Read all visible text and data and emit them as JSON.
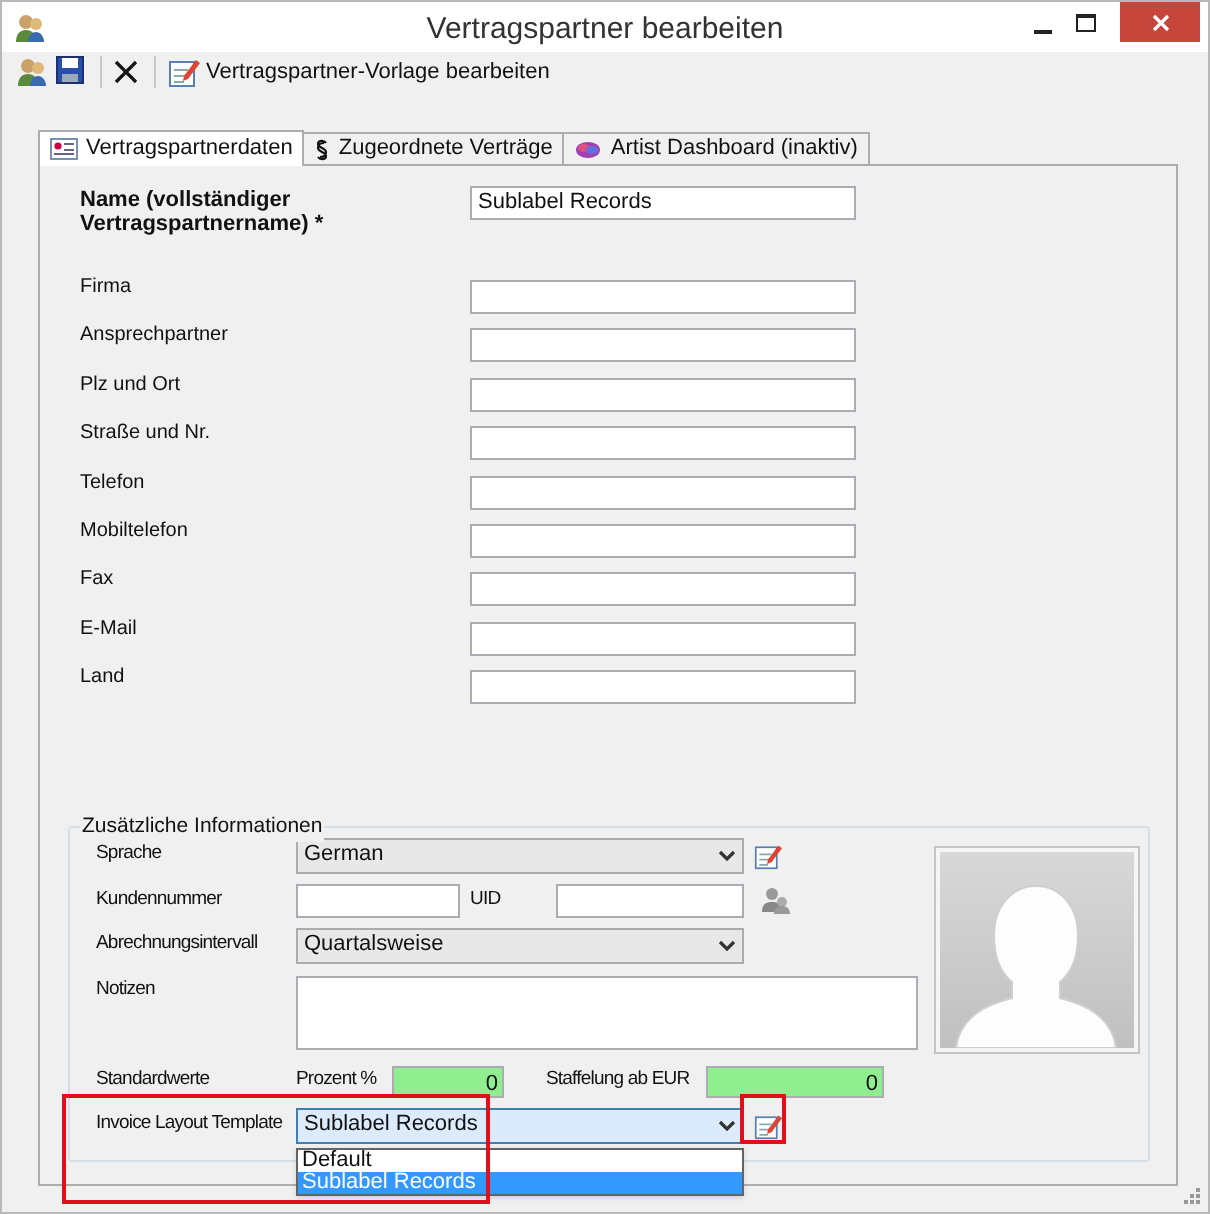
{
  "window": {
    "title": "Vertragspartner bearbeiten"
  },
  "toolbar": {
    "template_button": "Vertragspartner-Vorlage bearbeiten"
  },
  "tabs": [
    {
      "label": "Vertragspartnerdaten",
      "selected": true,
      "kind": "card"
    },
    {
      "label": "Zugeordnete Verträge",
      "selected": false,
      "kind": "section"
    },
    {
      "label": "Artist Dashboard (inaktiv)",
      "selected": false,
      "kind": "dashboard"
    }
  ],
  "fields": [
    {
      "label": "Name (vollständiger Vertragspartnername) *",
      "value": "Sublabel Records",
      "required": true
    },
    {
      "label": "Firma",
      "required": false
    },
    {
      "label": "Ansprechpartner",
      "required": false
    },
    {
      "label": "Plz und Ort",
      "required": false
    },
    {
      "label": "Straße und Nr.",
      "required": false
    },
    {
      "label": "Telefon",
      "required": false
    },
    {
      "label": "Mobiltelefon",
      "required": false
    },
    {
      "label": "Fax",
      "required": false
    },
    {
      "label": "E-Mail",
      "required": false
    },
    {
      "label": "Land",
      "required": false
    }
  ],
  "additional": {
    "title": "Zusätzliche Informationen",
    "language": {
      "label": "Sprache",
      "value": "German"
    },
    "customer_number": {
      "label": "Kundennummer"
    },
    "uid": {
      "label": "UID"
    },
    "billing_interval": {
      "label": "Abrechnungsintervall",
      "value": "Quartalsweise"
    },
    "notes": {
      "label": "Notizen"
    },
    "defaults": {
      "label": "Standardwerte",
      "percent_label": "Prozent %",
      "percent_value": "0",
      "tier_label": "Staffelung ab EUR",
      "tier_value": "0"
    },
    "invoice_template": {
      "label": "Invoice Layout Template",
      "value": "Sublabel Records",
      "expanded": true,
      "annotated": true,
      "options": [
        {
          "label": "Default",
          "selected": false
        },
        {
          "label": "Sublabel Records",
          "selected": true
        }
      ]
    }
  }
}
